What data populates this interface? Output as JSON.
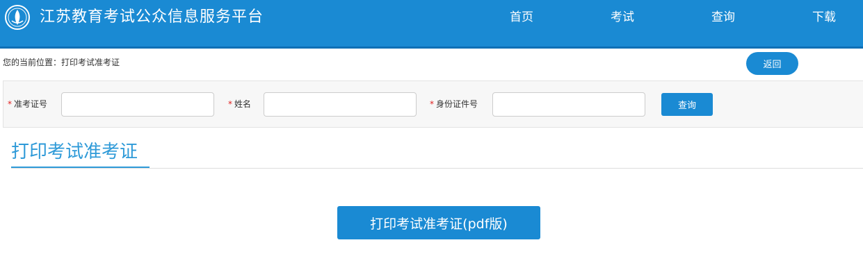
{
  "header": {
    "site_title": "江苏教育考试公众信息服务平台",
    "logo_icon": "education-exam-seal-icon",
    "nav": [
      {
        "label": "首页"
      },
      {
        "label": "考试"
      },
      {
        "label": "查询"
      },
      {
        "label": "下载"
      }
    ]
  },
  "breadcrumb": {
    "text": "您的当前位置：打印考试准考证"
  },
  "back_button": {
    "label": "返回"
  },
  "search_form": {
    "required_mark": "*",
    "fields": [
      {
        "label": "准考证号",
        "value": "",
        "placeholder": ""
      },
      {
        "label": "姓名",
        "value": "",
        "placeholder": ""
      },
      {
        "label": "身份证件号",
        "value": "",
        "placeholder": ""
      }
    ],
    "submit_label": "查询"
  },
  "section": {
    "title": "打印考试准考证"
  },
  "print_button": {
    "label": "打印考试准考证(pdf版)"
  },
  "colors": {
    "primary": "#1a8ad3",
    "title_blue": "#2e9ad8",
    "required_red": "#e02020",
    "panel_bg": "#f7f7f7"
  }
}
